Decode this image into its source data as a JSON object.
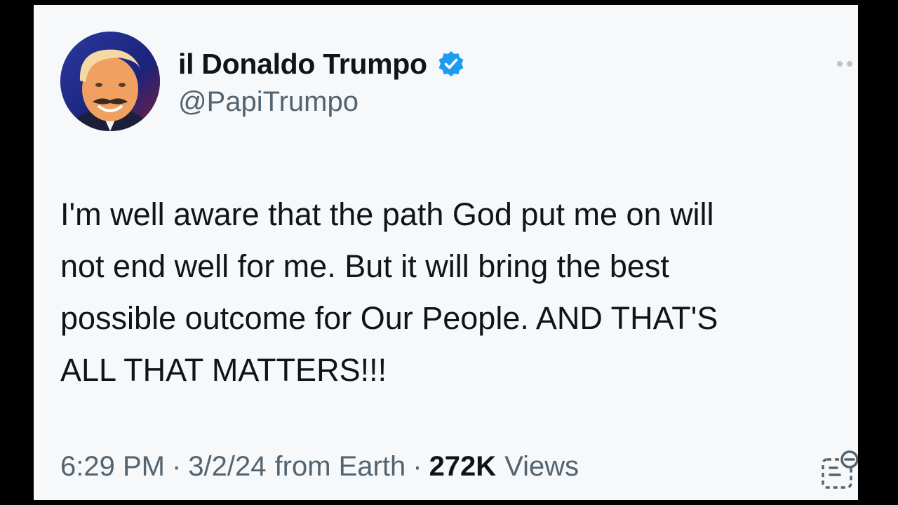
{
  "tweet": {
    "display_name": "il Donaldo Trumpo",
    "handle": "@PapiTrumpo",
    "verified_icon": "verified-badge-icon",
    "more_icon": "more-options-icon",
    "text": "I'm well aware that the path God put me on will\nnot end well for me. But it will bring the best\npossible outcome for Our People. AND THAT'S\nALL THAT MATTERS!!!",
    "time": "6:29 PM",
    "date": "3/2/24",
    "source": "from Earth",
    "separator": "·",
    "views_count": "272K",
    "views_label": "Views",
    "analytics_icon": "analytics-icon"
  },
  "colors": {
    "card_bg": "#f7f8f9",
    "text_primary": "#0f1419",
    "text_secondary": "#536471",
    "verified_blue": "#1d9bf0",
    "frame": "#000000"
  }
}
